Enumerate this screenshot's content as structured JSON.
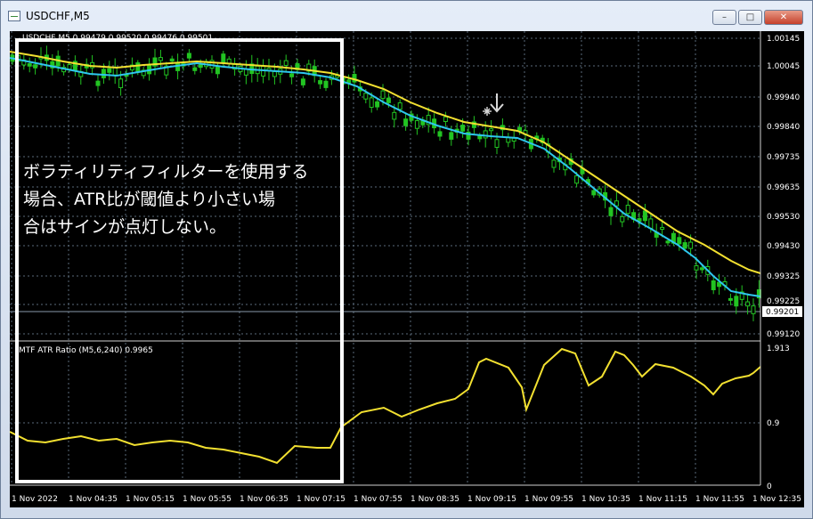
{
  "window": {
    "title": "USDCHF,M5",
    "controls": {
      "minimize": "–",
      "maximize": "□",
      "close": "✕"
    }
  },
  "chart": {
    "symbol_info": "USDCHF,M5  0.99479 0.99520 0.99476 0.99501",
    "indicator_label": "MTF ATR Ratio  (M5,6,240) 0.9965",
    "current_price": "0.99201",
    "price_axis": [
      "1.00145",
      "1.00045",
      "0.99940",
      "0.99840",
      "0.99735",
      "0.99635",
      "0.99530",
      "0.99430",
      "0.99325",
      "0.99225",
      "0.99120"
    ],
    "indicator_axis": [
      "1.913",
      "0.9",
      "0"
    ],
    "time_axis": [
      "1 Nov 2022",
      "1 Nov 04:35",
      "1 Nov 05:15",
      "1 Nov 05:55",
      "1 Nov 06:35",
      "1 Nov 07:15",
      "1 Nov 07:55",
      "1 Nov 08:35",
      "1 Nov 09:15",
      "1 Nov 09:55",
      "1 Nov 10:35",
      "1 Nov 11:15",
      "1 Nov 11:55",
      "1 Nov 12:35"
    ],
    "annotation": "ボラティリティフィルターを使用する\n場合、ATR比が閾値より小さい場\n合はサインが点灯しない。",
    "colors": {
      "background": "#000000",
      "candle": "#22c422",
      "ma_slow": "#f2e030",
      "ma_fast": "#2ec6ee",
      "atr_ratio": "#f2e030",
      "highlight_box": "#ffffff",
      "grid": "#5a6a7a"
    }
  }
}
